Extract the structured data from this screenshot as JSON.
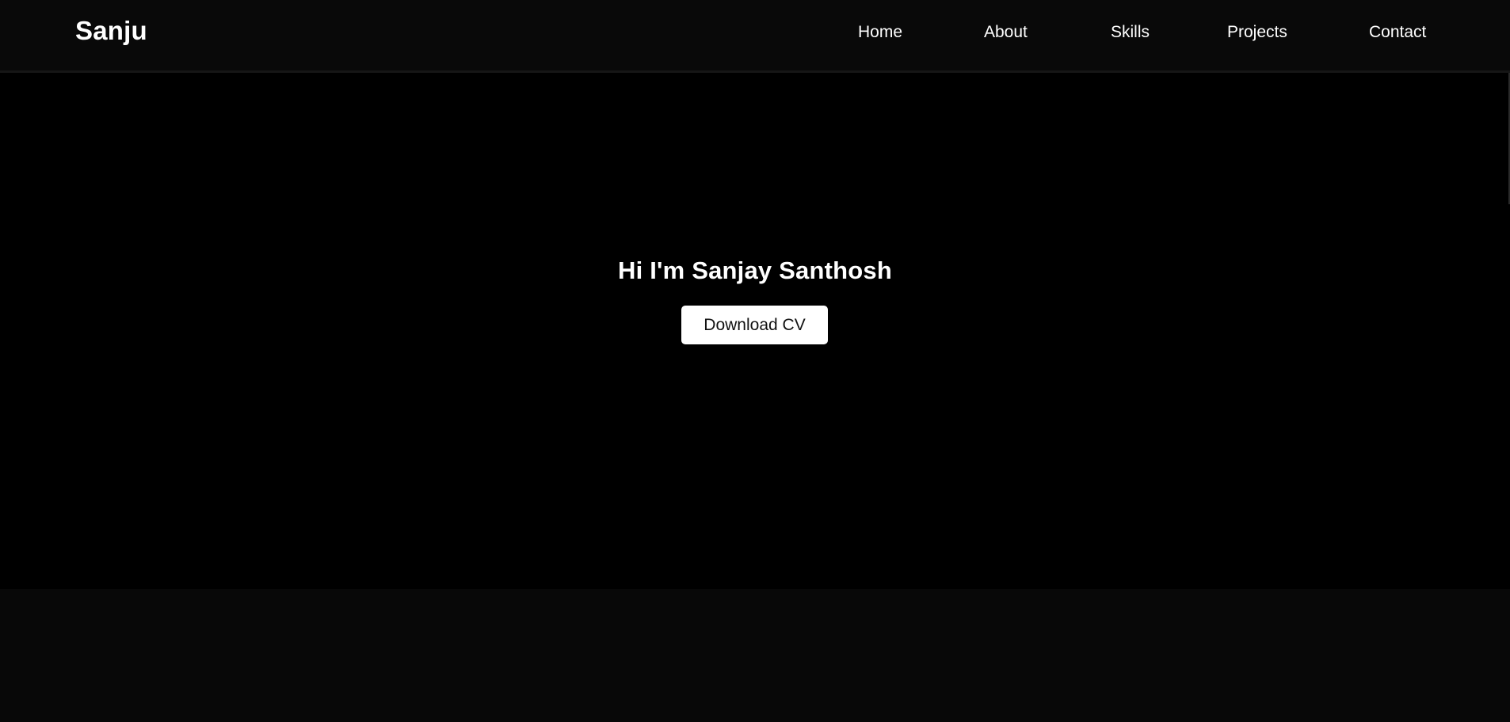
{
  "header": {
    "logo": "Sanju",
    "nav": {
      "home": "Home",
      "about": "About",
      "skills": "Skills",
      "projects": "Projects",
      "contact": "Contact"
    }
  },
  "hero": {
    "title": "Hi I'm Sanjay Santhosh",
    "cta_label": "Download CV"
  },
  "colors": {
    "nav_background": "#090909",
    "hero_background": "#000000",
    "page_background": "#080808",
    "text": "#ffffff",
    "button_background": "#ffffff",
    "button_text": "#111111"
  }
}
